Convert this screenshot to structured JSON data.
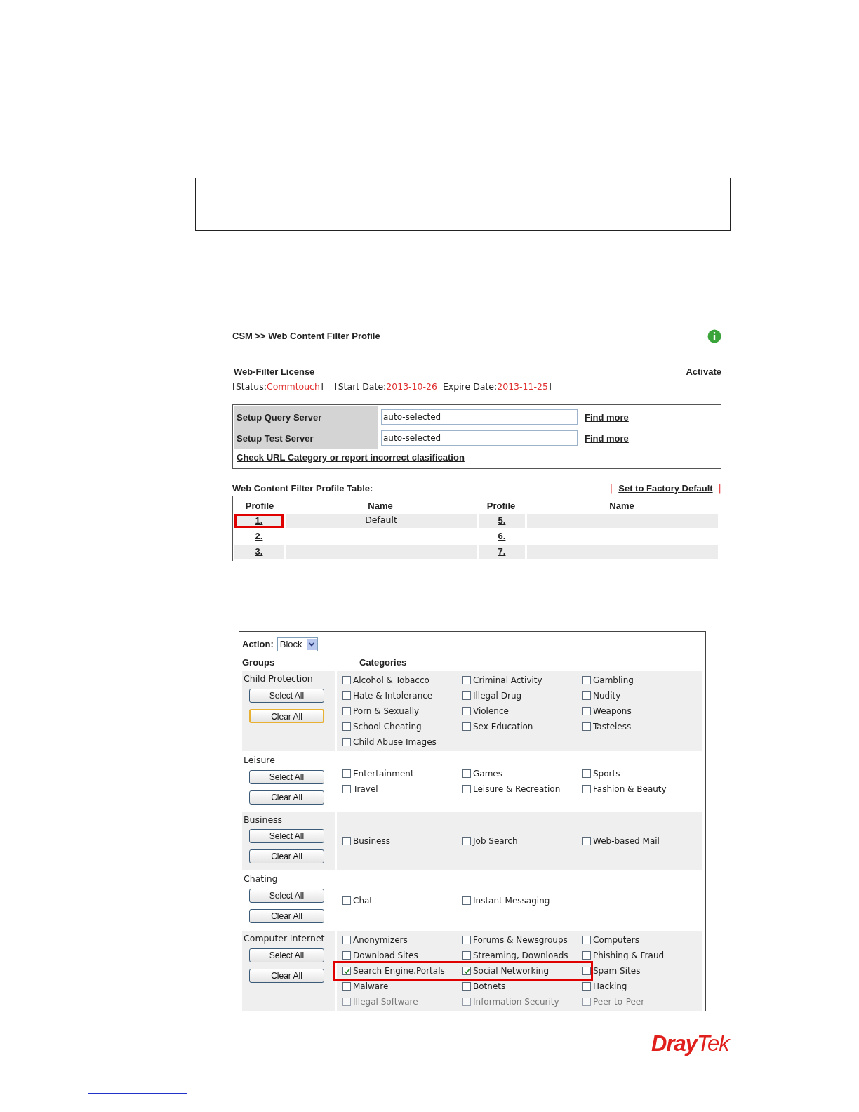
{
  "breadcrumb": "CSM >> Web Content Filter Profile",
  "license": {
    "title": "Web-Filter License",
    "activate": "Activate",
    "status_label": "[Status:",
    "status_value": "Commtouch",
    "status_end": "]",
    "start_label": "[Start Date:",
    "start_value": "2013-10-26",
    "expire_label": "Expire Date:",
    "expire_value": "2013-11-25",
    "end": "]"
  },
  "servers": [
    {
      "label": "Setup Query Server",
      "value": "auto-selected",
      "link": "Find more"
    },
    {
      "label": "Setup Test Server",
      "value": "auto-selected",
      "link": "Find more"
    }
  ],
  "check_url_link": "Check URL Category or report incorrect clasification",
  "profile_table": {
    "title": "Web Content Filter Profile Table:",
    "separator": "|",
    "factory_link": "Set to Factory Default",
    "columns": [
      "Profile",
      "Name",
      "Profile",
      "Name"
    ],
    "rows": [
      {
        "profile_a": "1.",
        "name_a": "Default",
        "profile_b": "5.",
        "highlighted": true
      },
      {
        "profile_a": "2.",
        "profile_b": "6.",
        "highlighted": false
      },
      {
        "profile_a": "3.",
        "profile_b": "7.",
        "highlighted": false
      }
    ]
  },
  "action": {
    "label": "Action:",
    "value": "Block"
  },
  "headers": {
    "groups": "Groups",
    "categories": "Categories"
  },
  "groups": [
    {
      "name": "Child Protection",
      "select_all": "Select All",
      "clear_all": "Clear All",
      "clear_focused": true,
      "rows": [
        [
          {
            "label": "Alcohol & Tobacco",
            "checked": false,
            "highlighted": false
          },
          {
            "label": "Criminal Activity",
            "checked": false,
            "highlighted": false
          },
          {
            "label": "Gambling",
            "checked": false,
            "highlighted": false
          }
        ],
        [
          {
            "label": "Hate & Intolerance",
            "checked": false,
            "highlighted": false
          },
          {
            "label": "Illegal Drug",
            "checked": false,
            "highlighted": false
          },
          {
            "label": "Nudity",
            "checked": false,
            "highlighted": false
          }
        ],
        [
          {
            "label": "Porn & Sexually",
            "checked": false,
            "highlighted": false
          },
          {
            "label": "Violence",
            "checked": false,
            "highlighted": false
          },
          {
            "label": "Weapons",
            "checked": false,
            "highlighted": false
          }
        ],
        [
          {
            "label": "School Cheating",
            "checked": false,
            "highlighted": false
          },
          {
            "label": "Sex Education",
            "checked": false,
            "highlighted": false
          },
          {
            "label": "Tasteless",
            "checked": false,
            "highlighted": false
          }
        ],
        [
          {
            "label": "Child Abuse Images",
            "checked": false,
            "highlighted": false
          }
        ]
      ]
    },
    {
      "name": "Leisure",
      "select_all": "Select All",
      "clear_all": "Clear All",
      "clear_focused": false,
      "rows": [
        [
          {
            "label": "Entertainment",
            "checked": false,
            "highlighted": false
          },
          {
            "label": "Games",
            "checked": false,
            "highlighted": false
          },
          {
            "label": "Sports",
            "checked": false,
            "highlighted": false
          }
        ],
        [
          {
            "label": "Travel",
            "checked": false,
            "highlighted": false
          },
          {
            "label": "Leisure & Recreation",
            "checked": false,
            "highlighted": false
          },
          {
            "label": "Fashion & Beauty",
            "checked": false,
            "highlighted": false
          }
        ]
      ]
    },
    {
      "name": "Business",
      "select_all": "Select All",
      "clear_all": "Clear All",
      "clear_focused": false,
      "rows": [
        [
          {
            "label": "Business",
            "checked": false,
            "highlighted": false
          },
          {
            "label": "Job Search",
            "checked": false,
            "highlighted": false
          },
          {
            "label": "Web-based Mail",
            "checked": false,
            "highlighted": false
          }
        ]
      ]
    },
    {
      "name": "Chating",
      "select_all": "Select All",
      "clear_all": "Clear All",
      "clear_focused": false,
      "rows": [
        [
          {
            "label": "Chat",
            "checked": false,
            "highlighted": false
          },
          {
            "label": "Instant Messaging",
            "checked": false,
            "highlighted": false
          }
        ]
      ]
    },
    {
      "name": "Computer-Internet",
      "select_all": "Select All",
      "clear_all": "Clear All",
      "clear_focused": false,
      "rows": [
        [
          {
            "label": "Anonymizers",
            "checked": false,
            "highlighted": false
          },
          {
            "label": "Forums & Newsgroups",
            "checked": false,
            "highlighted": false
          },
          {
            "label": "Computers",
            "checked": false,
            "highlighted": false
          }
        ],
        [
          {
            "label": "Download Sites",
            "checked": false,
            "highlighted": false
          },
          {
            "label": "Streaming, Downloads",
            "checked": false,
            "highlighted": false
          },
          {
            "label": "Phishing & Fraud",
            "checked": false,
            "highlighted": false
          }
        ],
        [
          {
            "label": "Search Engine,Portals",
            "checked": true,
            "highlighted": true
          },
          {
            "label": "Social Networking",
            "checked": true,
            "highlighted": true
          },
          {
            "label": "Spam Sites",
            "checked": false,
            "highlighted": false
          }
        ],
        [
          {
            "label": "Malware",
            "checked": false,
            "highlighted": false
          },
          {
            "label": "Botnets",
            "checked": false,
            "highlighted": false
          },
          {
            "label": "Hacking",
            "checked": false,
            "highlighted": false
          }
        ],
        [
          {
            "label": "Illegal Software",
            "checked": false,
            "highlighted": false,
            "faded": true
          },
          {
            "label": "Information Security",
            "checked": false,
            "highlighted": false,
            "faded": true
          },
          {
            "label": "Peer-to-Peer",
            "checked": false,
            "highlighted": false,
            "faded": true
          }
        ]
      ]
    }
  ],
  "logo": {
    "part_a": "Dray",
    "part_b": "Tek"
  }
}
